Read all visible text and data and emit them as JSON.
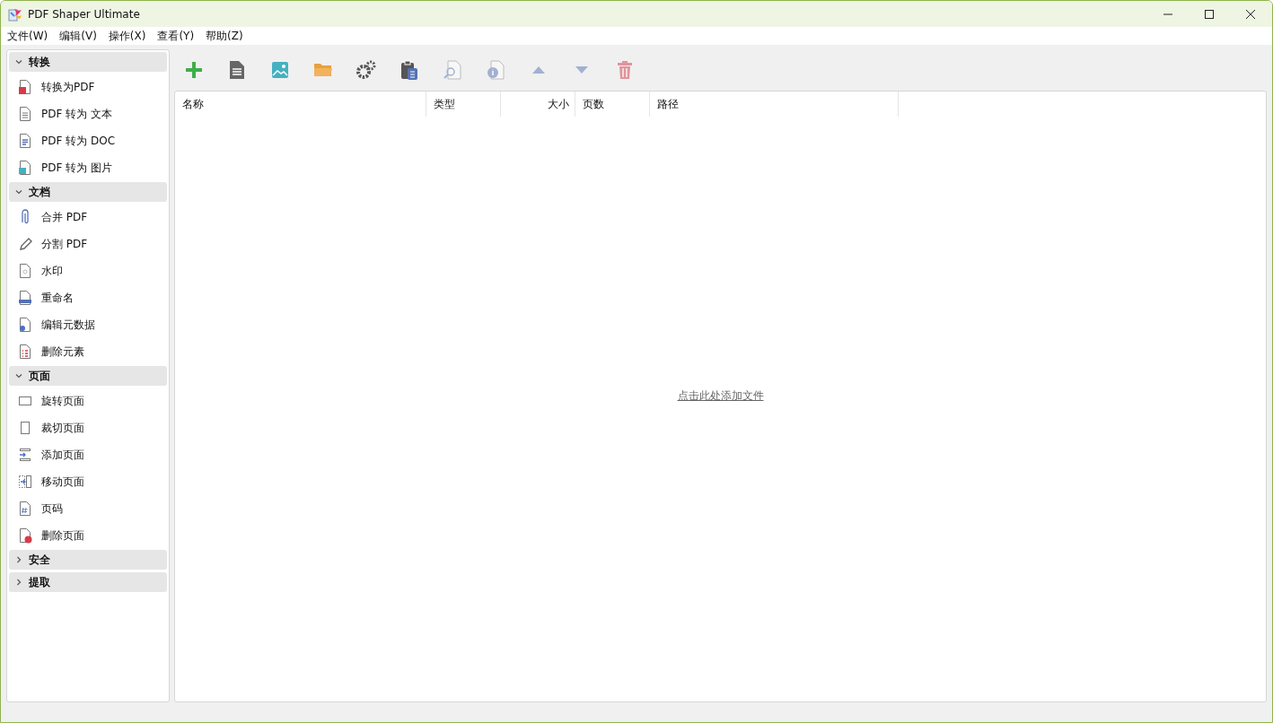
{
  "window": {
    "title": "PDF Shaper Ultimate"
  },
  "menu": [
    "文件(W)",
    "编辑(V)",
    "操作(X)",
    "查看(Y)",
    "帮助(Z)"
  ],
  "sidebar": {
    "groups": [
      {
        "label": "转换",
        "expanded": true,
        "items": [
          {
            "label": "转换为PDF",
            "kind": "to-pdf"
          },
          {
            "label": "PDF 转为 文本",
            "kind": "text"
          },
          {
            "label": "PDF 转为 DOC",
            "kind": "doc"
          },
          {
            "label": "PDF 转为 图片",
            "kind": "image"
          }
        ]
      },
      {
        "label": "文档",
        "expanded": true,
        "items": [
          {
            "label": "合并 PDF",
            "kind": "clip"
          },
          {
            "label": "分割 PDF",
            "kind": "pencil"
          },
          {
            "label": "水印",
            "kind": "watermark"
          },
          {
            "label": "重命名",
            "kind": "rename"
          },
          {
            "label": "编辑元数据",
            "kind": "metadata"
          },
          {
            "label": "删除元素",
            "kind": "list"
          }
        ]
      },
      {
        "label": "页面",
        "expanded": true,
        "items": [
          {
            "label": "旋转页面",
            "kind": "landscape"
          },
          {
            "label": "裁切页面",
            "kind": "portrait"
          },
          {
            "label": "添加页面",
            "kind": "insert"
          },
          {
            "label": "移动页面",
            "kind": "move"
          },
          {
            "label": "页码",
            "kind": "number"
          },
          {
            "label": "删除页面",
            "kind": "delete-page"
          }
        ]
      },
      {
        "label": "安全",
        "expanded": false
      },
      {
        "label": "提取",
        "expanded": false
      }
    ]
  },
  "toolbar": [
    {
      "kind": "add",
      "disabled": false
    },
    {
      "kind": "document",
      "disabled": false
    },
    {
      "kind": "image",
      "disabled": false
    },
    {
      "kind": "folder",
      "disabled": false
    },
    {
      "kind": "gears",
      "disabled": false
    },
    {
      "kind": "clipboard",
      "disabled": false
    },
    {
      "kind": "preview",
      "disabled": true
    },
    {
      "kind": "info",
      "disabled": true
    },
    {
      "kind": "up",
      "disabled": true
    },
    {
      "kind": "down",
      "disabled": true
    },
    {
      "kind": "delete",
      "disabled": true
    }
  ],
  "table": {
    "columns": [
      {
        "label": "名称"
      },
      {
        "label": "类型"
      },
      {
        "label": "大小"
      },
      {
        "label": "页数"
      },
      {
        "label": "路径"
      }
    ],
    "empty_link": "点击此处添加文件"
  }
}
